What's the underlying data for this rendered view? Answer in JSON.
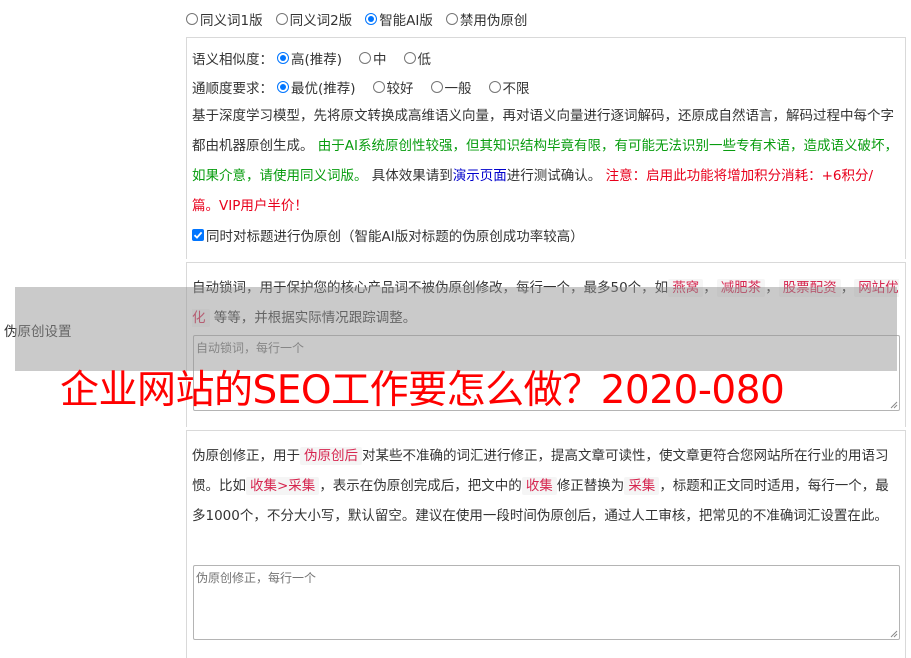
{
  "version_options": [
    {
      "label": "同义词1版",
      "selected": false
    },
    {
      "label": "同义词2版",
      "selected": false
    },
    {
      "label": "智能AI版",
      "selected": true
    },
    {
      "label": "禁用伪原创",
      "selected": false
    }
  ],
  "similarity": {
    "label": "语义相似度：",
    "options": [
      {
        "label": "高(推荐)",
        "selected": true
      },
      {
        "label": "中",
        "selected": false
      },
      {
        "label": "低",
        "selected": false
      }
    ]
  },
  "fluency": {
    "label": "通顺度要求：",
    "options": [
      {
        "label": "最优(推荐)",
        "selected": true
      },
      {
        "label": "较好",
        "selected": false
      },
      {
        "label": "一般",
        "selected": false
      },
      {
        "label": "不限",
        "selected": false
      }
    ]
  },
  "ai_description": {
    "part1": "基于深度学习模型，先将原文转换成高维语义向量，再对语义向量进行逐词解码，还原成自然语言，解码过程中每个字都由机器原创生成。 ",
    "part2_green": "由于AI系统原创性较强，但其知识结构毕竟有限，有可能无法识别一些专有术语，造成语义破坏，如果介意，请使用同义词版。",
    "part3": " 具体效果请到",
    "link": "演示页面",
    "part4": "进行测试确认。 ",
    "part5_red": "注意：启用此功能将增加积分消耗：+6积分/篇。VIP用户半价！"
  },
  "title_checkbox": {
    "checked": true,
    "label": "同时对标题进行伪原创（智能AI版对标题的伪原创成功率较高）"
  },
  "lock_words": {
    "desc_start": "自动锁词，用于保护您的核心产品词不被伪原创修改，每行一个，最多50个，如",
    "examples": [
      "燕窝",
      "减肥茶",
      "股票配资",
      "网站优化"
    ],
    "sep": "，",
    "desc_end": "等等，并根据实际情况跟踪调整。",
    "placeholder": "自动锁词，每行一个"
  },
  "correction": {
    "t1": "伪原创修正，用于",
    "chip1": "伪原创后",
    "t2": "对某些不准确的词汇进行修正，提高文章可读性，使文章更符合您网站所在行业的用语习惯。比如",
    "chip2": "收集>采集",
    "t3": "，表示在伪原创完成后，把文中的",
    "chip3": "收集",
    "t4": "修正替换为",
    "chip4": "采集",
    "t5": "，标题和正文同时适用，每行一个，最多1000个，不分大小写，默认留空。建议在使用一段时间伪原创后，通过人工审核，把常见的不准确词汇设置在此。",
    "placeholder": "伪原创修正，每行一个"
  },
  "left_label": "伪原创设置",
  "overlay_title": "企业网站的SEO工作要怎么做？2020-080",
  "colors": {
    "accent": "#0075ff",
    "green": "#089c0f",
    "red": "#e8001c",
    "link": "#0000cc",
    "overlay_title": "#ff0000"
  }
}
